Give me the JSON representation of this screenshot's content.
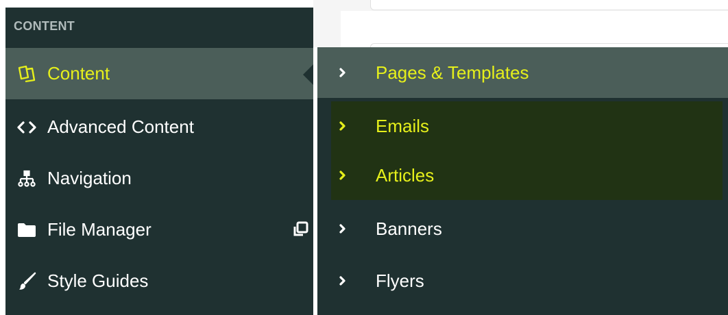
{
  "sidebar": {
    "section_header": "CONTENT",
    "items": [
      {
        "label": "Content",
        "icon": "content-pages-icon",
        "active": true
      },
      {
        "label": "Advanced Content",
        "icon": "code-icon",
        "active": false
      },
      {
        "label": "Navigation",
        "icon": "sitemap-icon",
        "active": false
      },
      {
        "label": "File Manager",
        "icon": "folder-icon",
        "active": false,
        "external": true
      },
      {
        "label": "Style Guides",
        "icon": "brush-icon",
        "active": false
      }
    ]
  },
  "submenu": {
    "items": [
      {
        "label": "Pages & Templates",
        "state": "active"
      },
      {
        "label": "Emails",
        "state": "highlighted"
      },
      {
        "label": "Articles",
        "state": "highlighted"
      },
      {
        "label": "Banners",
        "state": "normal"
      },
      {
        "label": "Flyers",
        "state": "normal"
      }
    ]
  },
  "colors": {
    "sidebar_bg": "#1f3131",
    "active_bg": "#4b5e59",
    "highlight_bg": "#213314",
    "accent_yellow": "#e6f01b",
    "text_white": "#ffffff",
    "section_header": "#b0bbbb"
  }
}
